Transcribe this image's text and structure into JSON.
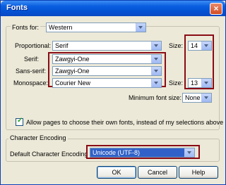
{
  "window": {
    "title": "Fonts",
    "close": "×"
  },
  "fonts_group": {
    "fonts_for_label": "Fonts for:",
    "fonts_for_value": "Western",
    "proportional_label": "Proportional:",
    "proportional_value": "Serif",
    "size_label": "Size:",
    "proportional_size": "14",
    "serif_label": "Serif:",
    "serif_value": "Zawgyi-One",
    "sans_serif_label": "Sans-serif:",
    "sans_serif_value": "Zawgyi-One",
    "monospace_label": "Monospace:",
    "monospace_value": "Courier New",
    "monospace_size_label": "Size:",
    "monospace_size": "13",
    "min_font_size_label": "Minimum font size:",
    "min_font_size_value": "None",
    "allow_pages_label": "Allow pages to choose their own fonts, instead of my selections above",
    "allow_pages_checked": true
  },
  "encoding_group": {
    "title": "Character Encoding",
    "default_label": "Default Character Encoding",
    "default_value": "Unicode (UTF-8)"
  },
  "buttons": {
    "ok": "OK",
    "cancel": "Cancel",
    "help": "Help"
  },
  "colors": {
    "highlight": "#8a0c16",
    "titlebar": "#0a5ee0",
    "selected": "#3161c8"
  }
}
